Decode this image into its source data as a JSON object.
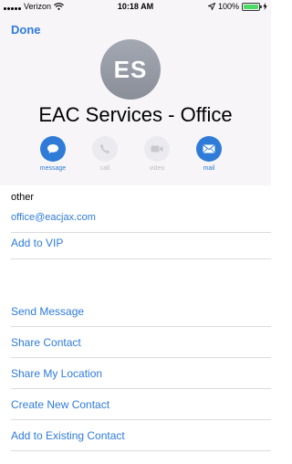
{
  "status_bar": {
    "carrier": "Verizon",
    "time": "10:18 AM",
    "battery_percent": "100%",
    "battery_level": 1.0
  },
  "nav": {
    "done_label": "Done"
  },
  "contact": {
    "initials": "ES",
    "name": "EAC Services - Office"
  },
  "actions": [
    {
      "label": "message",
      "icon": "message-icon",
      "enabled": true
    },
    {
      "label": "call",
      "icon": "phone-icon",
      "enabled": false
    },
    {
      "label": "video",
      "icon": "video-icon",
      "enabled": false
    },
    {
      "label": "mail",
      "icon": "mail-icon",
      "enabled": true
    }
  ],
  "email": {
    "label": "other",
    "value": "office@eacjax.com"
  },
  "vip": {
    "label": "Add to VIP"
  },
  "options": [
    "Send Message",
    "Share Contact",
    "Share My Location",
    "Create New Contact",
    "Add to Existing Contact"
  ],
  "colors": {
    "accent": "#2f7bd8",
    "header_bg": "#f7f5f8",
    "battery": "#4cd964",
    "disabled": "#bdbcc1"
  }
}
